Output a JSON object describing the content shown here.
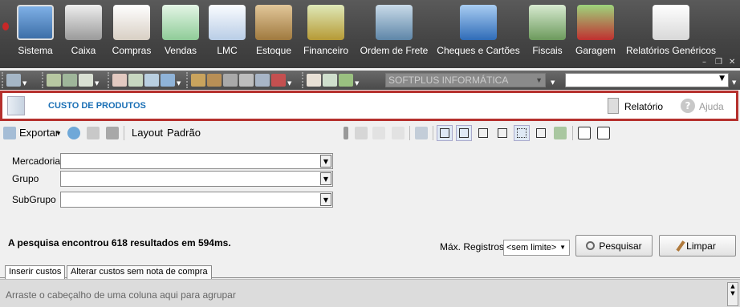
{
  "menu": [
    {
      "label": "Sistema",
      "icon": "computer-icon",
      "color": "#6a9bd6"
    },
    {
      "label": "Caixa",
      "icon": "cash-register-icon",
      "color": "#cfcfcf"
    },
    {
      "label": "Compras",
      "icon": "documents-icon",
      "color": "#e8e3dc"
    },
    {
      "label": "Vendas",
      "icon": "calculator-icon",
      "color": "#bfe0c4"
    },
    {
      "label": "LMC",
      "icon": "document-icon",
      "color": "#dbe6f3"
    },
    {
      "label": "Estoque",
      "icon": "box-icon",
      "color": "#c9a66b"
    },
    {
      "label": "Financeiro",
      "icon": "money-icon",
      "color": "#b9c98a"
    },
    {
      "label": "Ordem de Frete",
      "icon": "truck-icon",
      "color": "#8fb0c9"
    },
    {
      "label": "Cheques e Cartões",
      "icon": "cards-icon",
      "color": "#6c9fd8"
    },
    {
      "label": "Fiscais",
      "icon": "tax-icon",
      "color": "#9dbb8f"
    },
    {
      "label": "Garagem",
      "icon": "cars-icon",
      "color": "#7db55f"
    },
    {
      "label": "Relatórios Genéricos",
      "icon": "report-icon",
      "color": "#f2f2f2"
    }
  ],
  "toolbar2": {
    "company": "SOFTPLUS INFORMÁTICA",
    "combo_value": ""
  },
  "header": {
    "title": "CUSTO DE PRODUTOS",
    "report_label": "Relatório",
    "help_label": "Ajuda",
    "help_symbol": "?"
  },
  "actions": {
    "export_label": "Exportar",
    "layout_label": "Layout",
    "default_label": "Padrão"
  },
  "filters": [
    {
      "label": "Mercadoria",
      "value": ""
    },
    {
      "label": "Grupo",
      "value": ""
    },
    {
      "label": "SubGrupo",
      "value": ""
    }
  ],
  "result_text": "A pesquisa encontrou 618 resultados em 594ms.",
  "max_records": {
    "label": "Máx. Registros",
    "value": "<sem limite>"
  },
  "buttons": {
    "search": "Pesquisar",
    "clear": "Limpar"
  },
  "tabs": [
    {
      "label": "Inserir custos",
      "active": true
    },
    {
      "label": "Alterar custos sem nota de compra",
      "active": false
    }
  ],
  "group_hint": "Arraste o cabeçalho de uma coluna aqui para agrupar",
  "colors": {
    "accent_outline": "#b5302d",
    "title_blue": "#1a6fb5",
    "topbar": "#444444"
  }
}
